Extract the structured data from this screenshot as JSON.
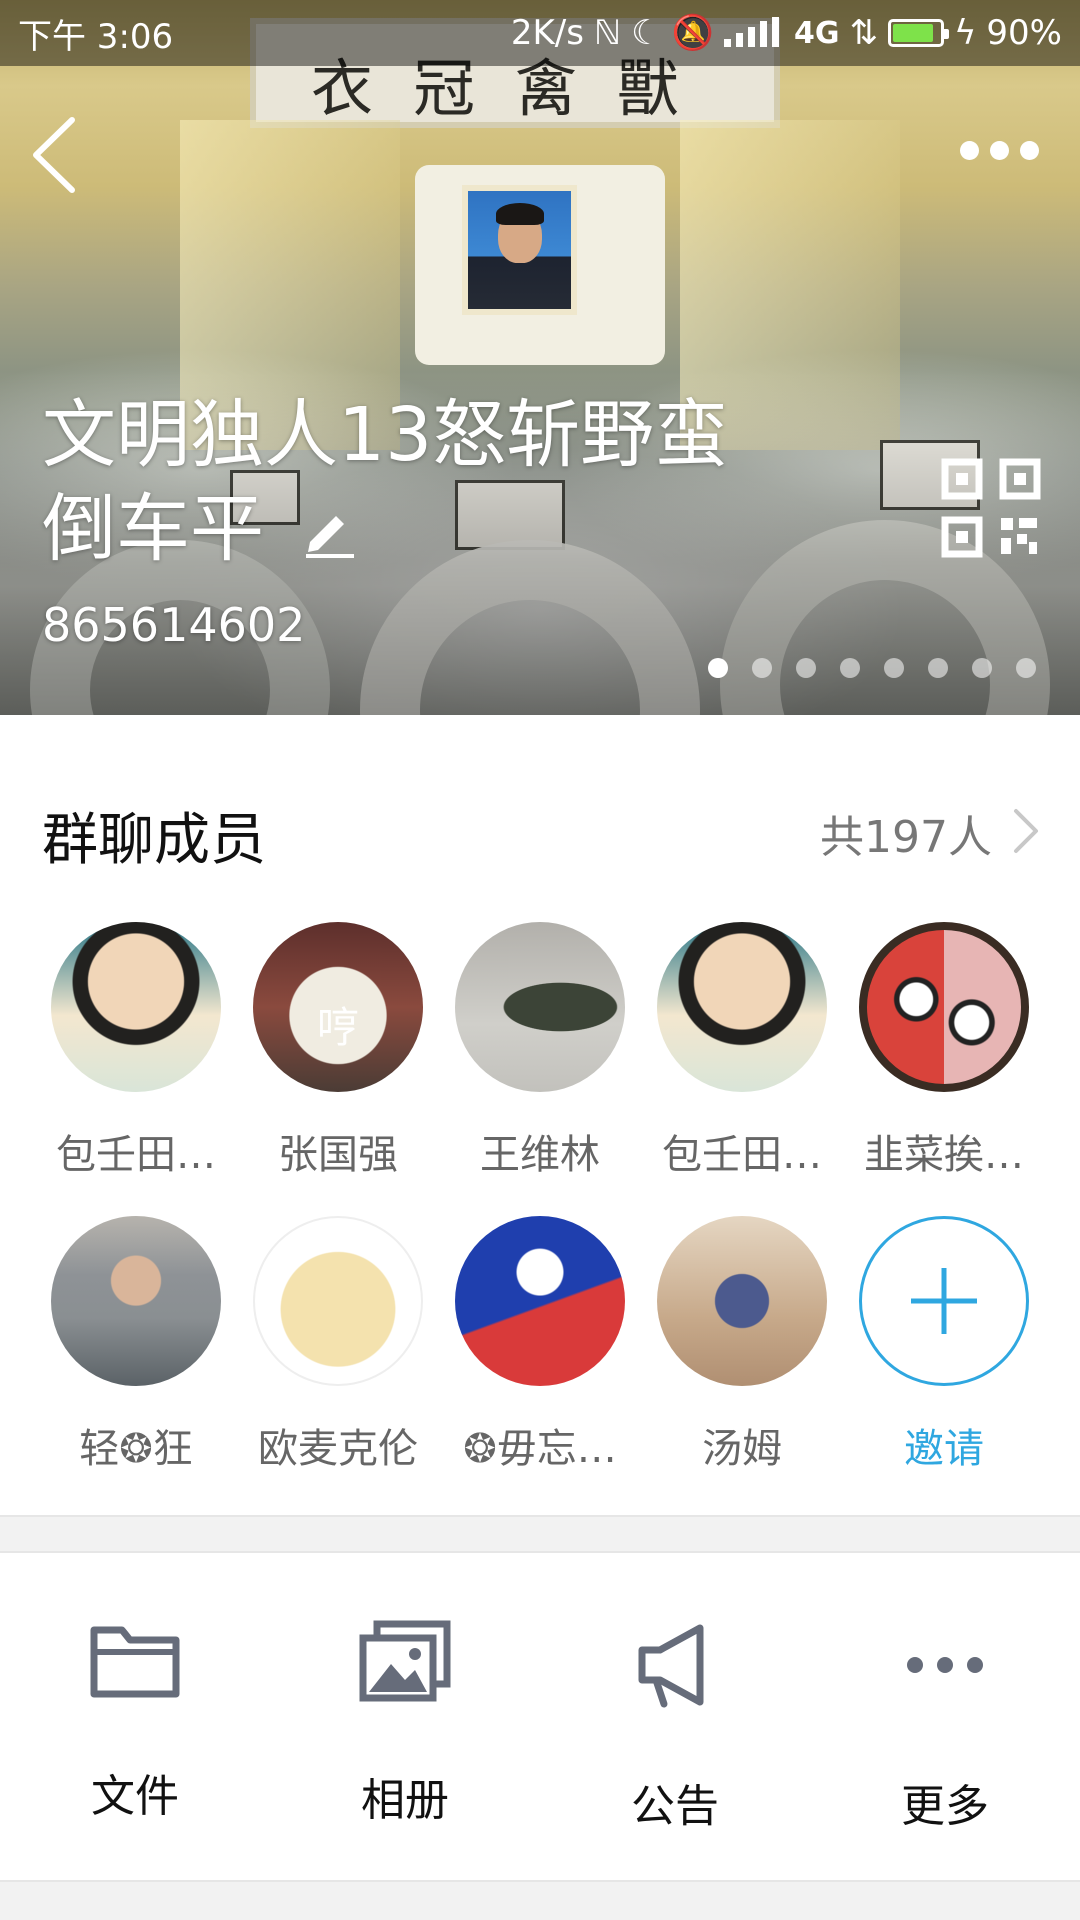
{
  "status_bar": {
    "time": "下午 3:06",
    "speed": "2K/s",
    "network": "4G",
    "battery": "90%",
    "battery_color": "#7ee24a"
  },
  "cover": {
    "banner_text": "衣冠禽獸",
    "group_name": "文明独人13怒斩野蛮倒车平",
    "group_id": "865614602",
    "page_count": 8,
    "active_page": 1
  },
  "members": {
    "section_title": "群聊成员",
    "count_text": "共197人",
    "list": [
      {
        "name": "包壬田…",
        "avatar": "avatar-upside-down-portrait"
      },
      {
        "name": "张国强",
        "avatar": "avatar-duck",
        "avatar_text": "哼"
      },
      {
        "name": "王维林",
        "avatar": "avatar-tank-man"
      },
      {
        "name": "包壬田…",
        "avatar": "avatar-upside-down-portrait"
      },
      {
        "name": "韭菜挨…",
        "avatar": "avatar-cartoon-face"
      },
      {
        "name": "轻❂狂",
        "avatar": "avatar-general"
      },
      {
        "name": "欧麦克伦",
        "avatar": "avatar-doge-smoking"
      },
      {
        "name": "❂毋忘…",
        "avatar": "avatar-flag"
      },
      {
        "name": "汤姆",
        "avatar": "avatar-tom-cat"
      }
    ],
    "invite_label": "邀请",
    "accent_color": "#2fa7e0"
  },
  "tools": [
    {
      "label": "文件",
      "icon": "folder-icon"
    },
    {
      "label": "相册",
      "icon": "album-icon"
    },
    {
      "label": "公告",
      "icon": "megaphone-icon"
    },
    {
      "label": "更多",
      "icon": "more-icon"
    }
  ]
}
